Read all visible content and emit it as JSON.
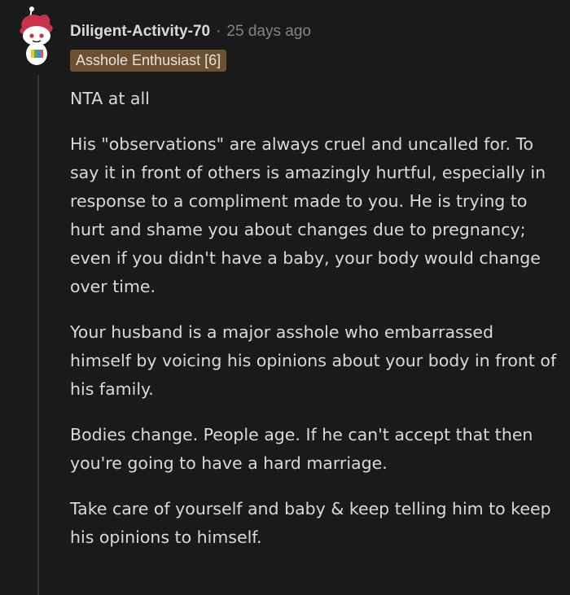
{
  "comment": {
    "author": "Diligent-Activity-70",
    "separator": "·",
    "time_ago": "25 days ago",
    "flair": "Asshole Enthusiast [6]",
    "avatar_icon": "reddit-snoo-avatar-icon",
    "paragraphs": [
      "NTA at all",
      "His \"observations\" are always cruel and uncalled for. To say it in front of others is amazingly hurtful, especially in response to a compliment made to you. He is trying to hurt and shame you about changes due to pregnancy; even if you didn't have a baby, your body would change over time.",
      "Your husband is a major asshole who embarrassed himself by voicing his opinions about your body in front of his family.",
      "Bodies change. People age. If he can't accept that then you're going to have a hard marriage.",
      "Take care of yourself and baby & keep telling him to keep his opinions to himself."
    ]
  },
  "colors": {
    "background": "#1a1a1b",
    "text": "#d7dadc",
    "meta": "#818384",
    "flair_bg": "#6b5131",
    "thread_line": "#343536"
  }
}
